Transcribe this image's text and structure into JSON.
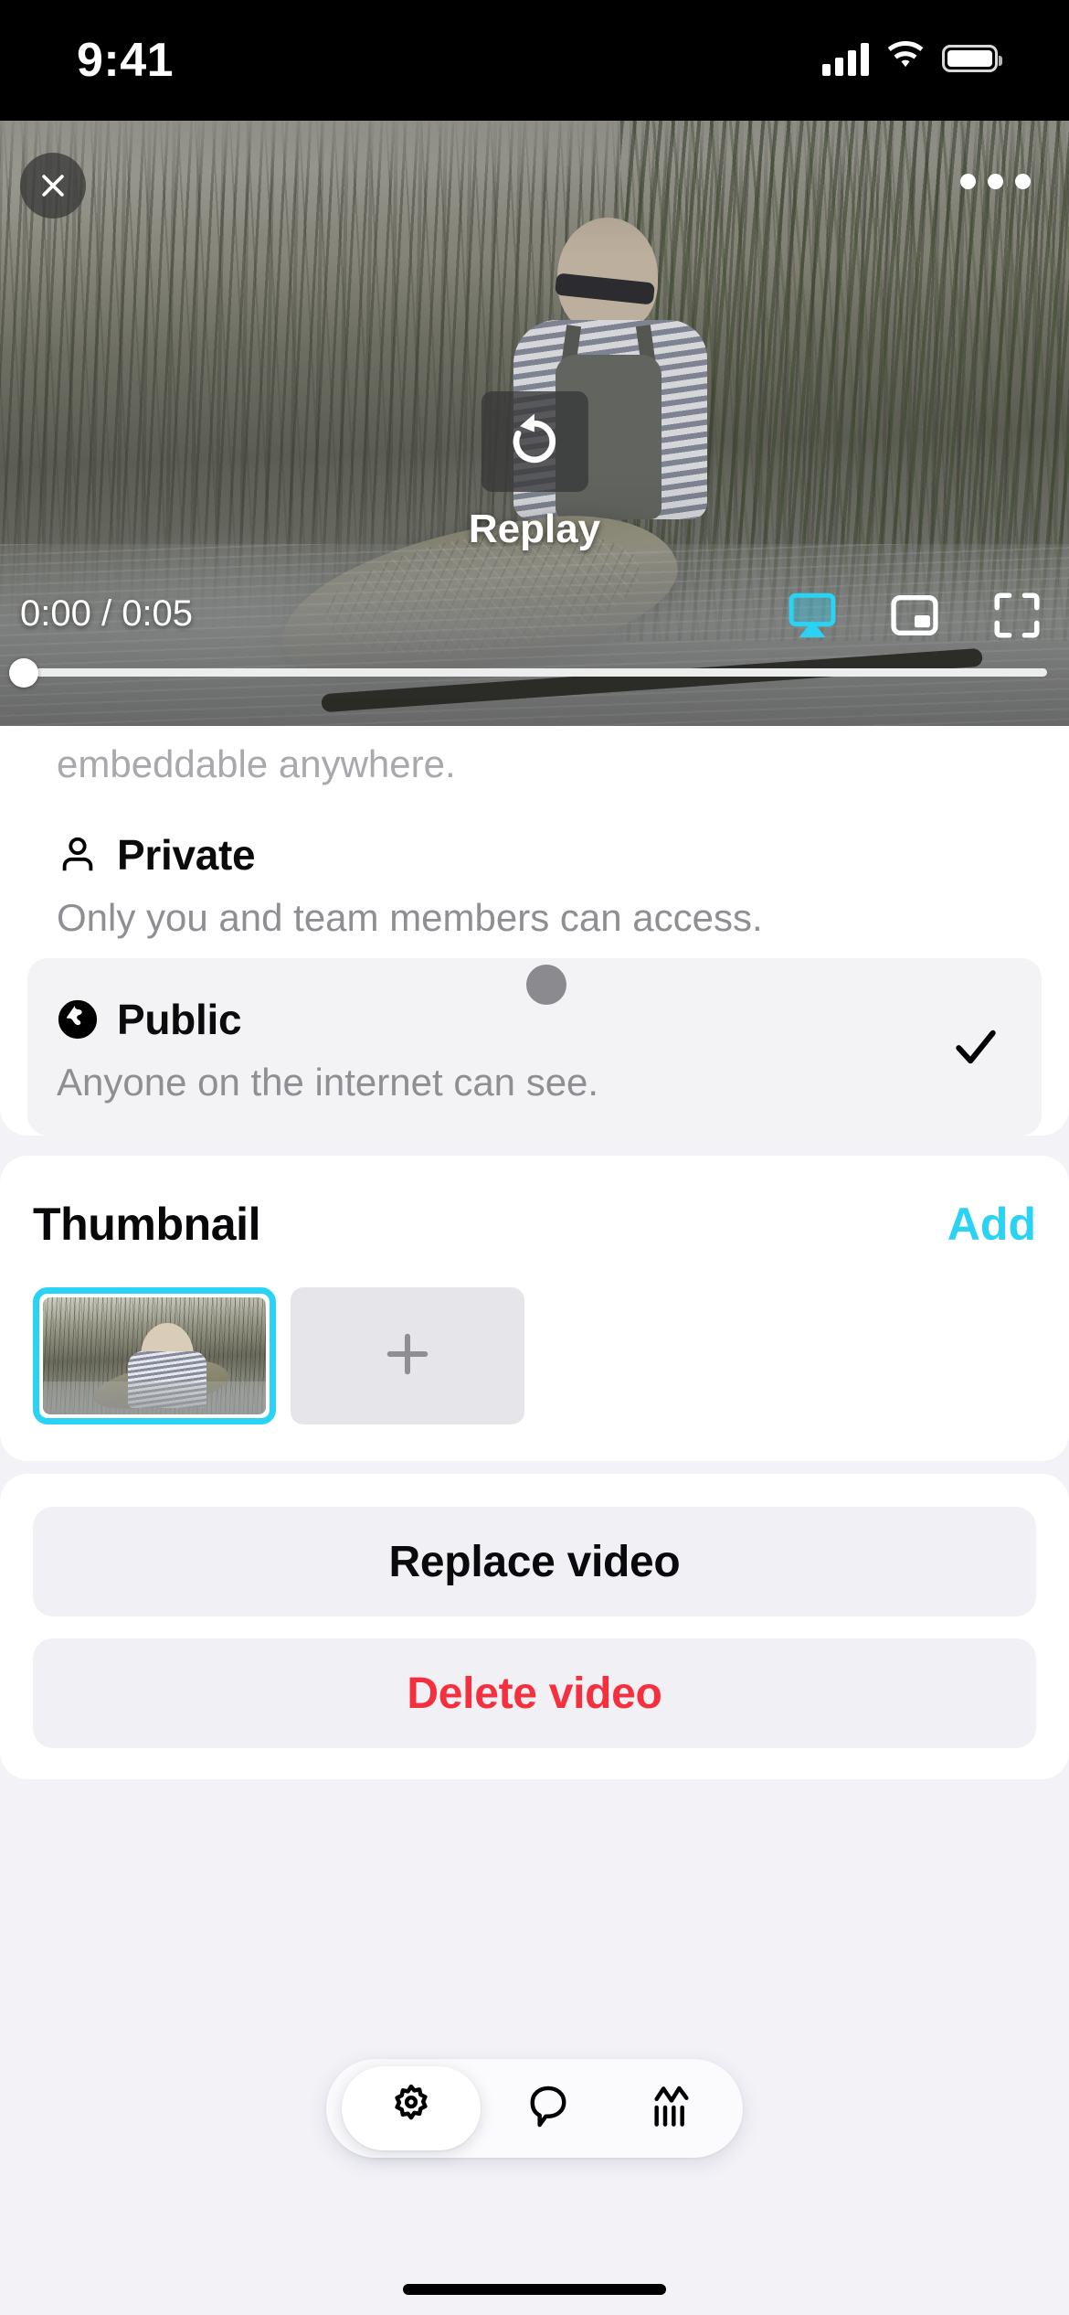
{
  "status_bar": {
    "time": "9:41",
    "signal_icon": "cellular-signal-icon",
    "wifi_icon": "wifi-icon",
    "battery_icon": "battery-icon"
  },
  "player": {
    "close_icon": "close-icon",
    "more_icon": "more-options-icon",
    "replay_icon": "replay-icon",
    "replay_label": "Replay",
    "timecode": "0:00 / 0:05",
    "current_time": "0:00",
    "duration": "0:05",
    "progress_percent": 0,
    "airplay_icon": "airplay-icon",
    "airplay_active_color": "#2ad2f4",
    "pip_icon": "picture-in-picture-icon",
    "fullscreen_icon": "fullscreen-icon"
  },
  "privacy": {
    "truncated_text": "embeddable anywhere.",
    "options": [
      {
        "icon": "person-icon",
        "title": "Private",
        "description": "Only you and team members can access.",
        "selected": false
      },
      {
        "icon": "globe-icon",
        "title": "Public",
        "description": "Anyone on the internet can see.",
        "selected": true,
        "check_icon": "checkmark-icon"
      }
    ]
  },
  "thumbnail": {
    "title": "Thumbnail",
    "add_label": "Add",
    "add_color": "#2ad2f4",
    "selected_border_color": "#2ad2f4",
    "add_slot_icon": "plus-icon"
  },
  "actions": {
    "replace_label": "Replace video",
    "delete_label": "Delete video",
    "delete_color": "#f5303e"
  },
  "tabbar": {
    "tabs": [
      {
        "icon": "gear-icon",
        "name": "settings",
        "active": true
      },
      {
        "icon": "comment-bubble-icon",
        "name": "comments",
        "active": false
      },
      {
        "icon": "analytics-chart-icon",
        "name": "analytics",
        "active": false
      }
    ]
  }
}
